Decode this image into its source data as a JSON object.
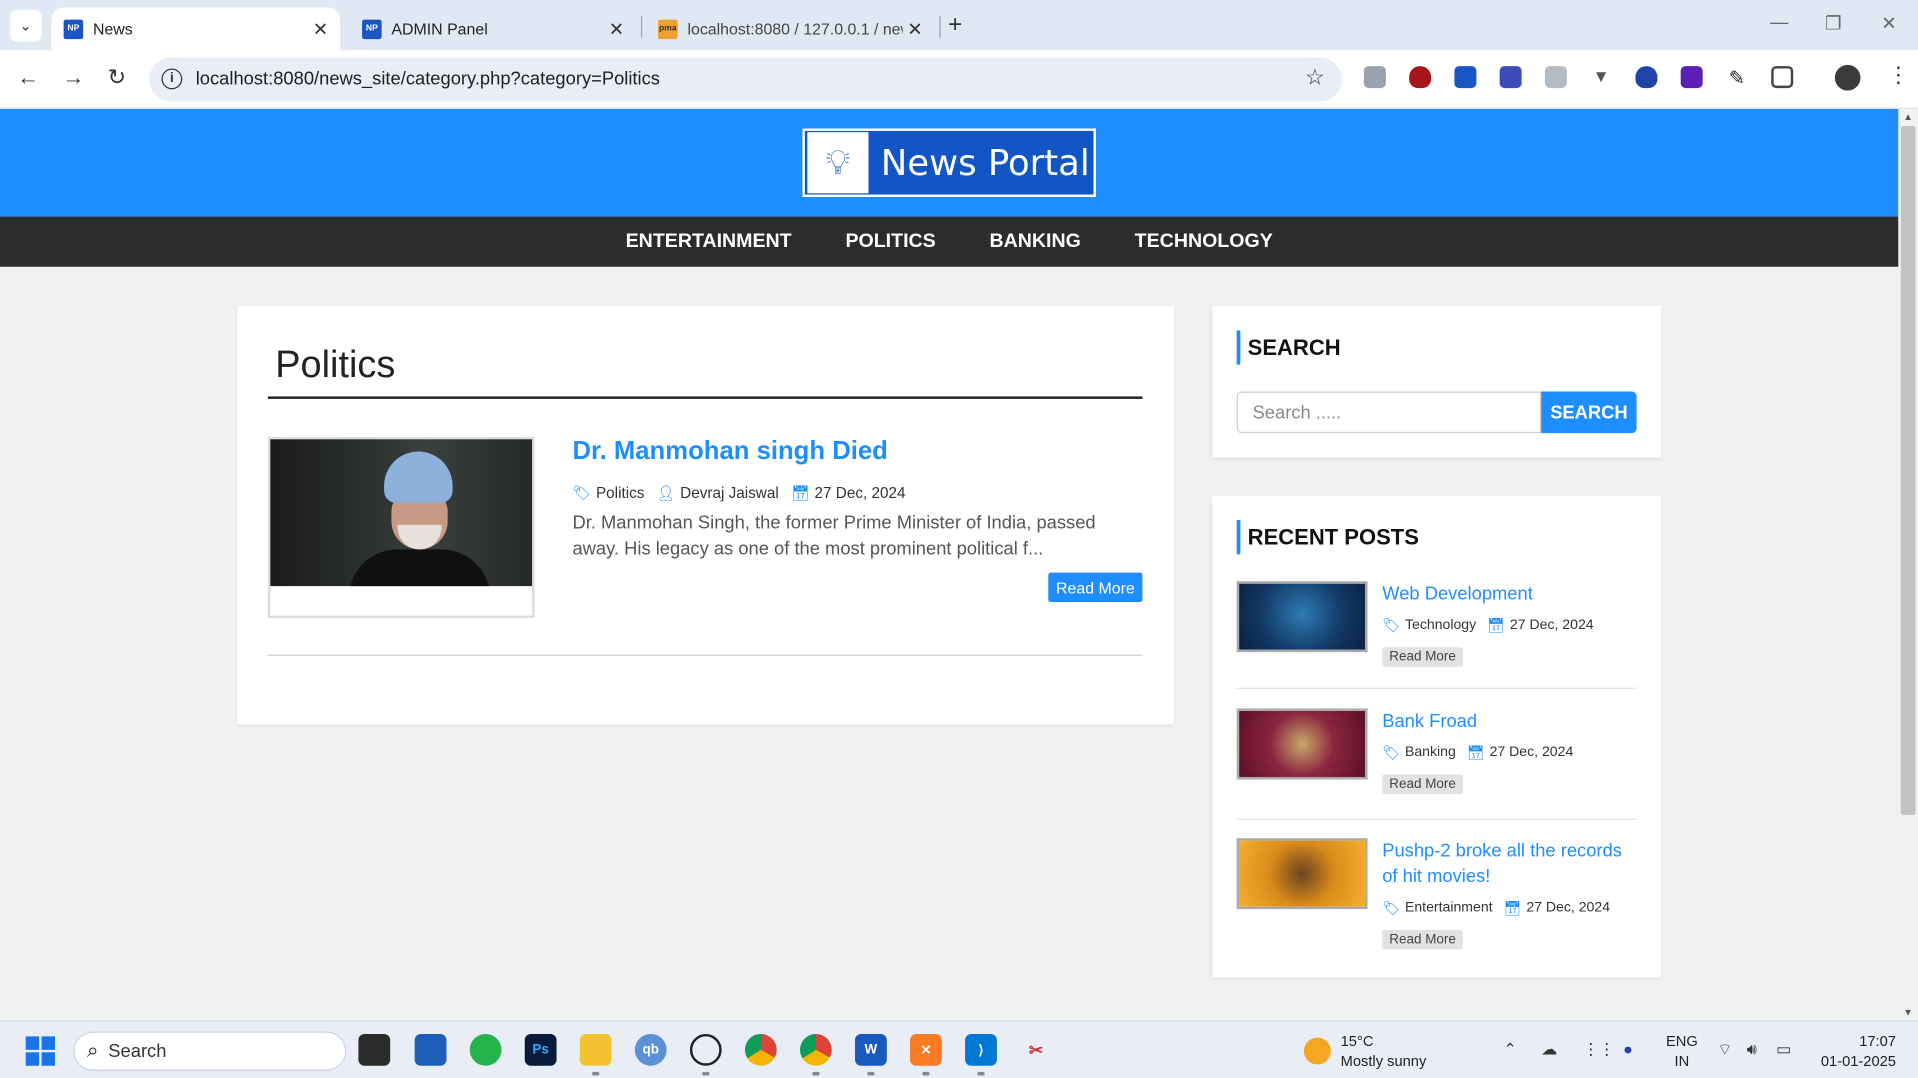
{
  "browser": {
    "tabs": [
      {
        "title": "News",
        "active": true
      },
      {
        "title": "ADMIN Panel",
        "active": false
      },
      {
        "title": "localhost:8080 / 127.0.0.1 / new",
        "active": false
      }
    ],
    "url": "localhost:8080/news_site/category.php?category=Politics"
  },
  "site": {
    "logo_text": "News Portal",
    "menu": [
      "ENTERTAINMENT",
      "POLITICS",
      "BANKING",
      "TECHNOLOGY"
    ],
    "category_title": "Politics",
    "post": {
      "title": "Dr. Manmohan singh Died",
      "category": "Politics",
      "author": "Devraj Jaiswal",
      "date": "27 Dec, 2024",
      "excerpt": "Dr. Manmohan Singh, the former Prime Minister of India, passed away. His legacy as one of the most prominent political f...",
      "read_more": "Read More"
    },
    "search": {
      "heading": "SEARCH",
      "placeholder": "Search .....",
      "button": "SEARCH"
    },
    "recent": {
      "heading": "RECENT POSTS",
      "posts": [
        {
          "title": "Web Development",
          "category": "Technology",
          "date": "27 Dec, 2024",
          "read_more": "Read More"
        },
        {
          "title": "Bank Froad",
          "category": "Banking",
          "date": "27 Dec, 2024",
          "read_more": "Read More"
        },
        {
          "title": "Pushp-2 broke all the records of hit movies!",
          "category": "Entertainment",
          "date": "27 Dec, 2024",
          "read_more": "Read More"
        }
      ]
    }
  },
  "taskbar": {
    "search_label": "Search",
    "weather_temp": "15°C",
    "weather_desc": "Mostly sunny",
    "lang1": "ENG",
    "lang2": "IN",
    "time": "17:07",
    "date": "01-01-2025"
  },
  "colors": {
    "brand_blue": "#1e8eff",
    "menu_dark": "#2c2c2c"
  }
}
